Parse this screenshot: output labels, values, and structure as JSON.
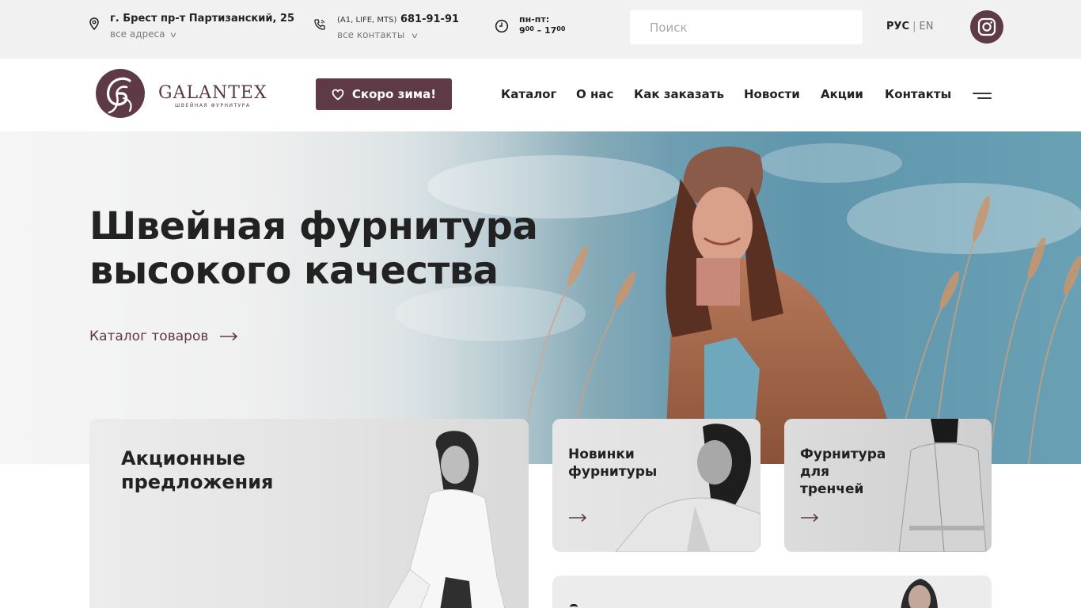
{
  "topbar": {
    "address": "г. Брест пр-т Партизанский, 25",
    "all_addresses": "все адреса",
    "phone_carriers": "(A1, LIFE, MTS)",
    "phone_number": "681-91-91",
    "all_contacts": "все контакты",
    "hours_days": "пн-пт:",
    "hours_from": "9",
    "hours_from_min": "00",
    "hours_dash": " – ",
    "hours_to": "17",
    "hours_to_min": "00",
    "search_placeholder": "Поиск",
    "lang_active": "РУС",
    "lang_separator": "|",
    "lang_other": "EN",
    "icons": [
      "location-pin-icon",
      "phone-icon",
      "clock-icon",
      "instagram-icon"
    ]
  },
  "header": {
    "logo_text": "GALANTEX",
    "logo_subtitle": "ШВЕЙНАЯ ФУРНИТУРА",
    "promo_button": "Скоро зима!",
    "nav": [
      "Каталог",
      "О нас",
      "Как заказать",
      "Новости",
      "Акции",
      "Контакты"
    ]
  },
  "hero": {
    "title_line1": "Швейная фурнитура",
    "title_line2": "высокого качества",
    "catalog_link": "Каталог товаров"
  },
  "cards": {
    "promo_line1": "Акционные",
    "promo_line2": "предложения",
    "new_line1": "Новинки",
    "new_line2": "фурнитуры",
    "trench_line1": "Фурнитура",
    "trench_line2": "для",
    "trench_line3": "тренчей"
  },
  "colors": {
    "brand": "#5d3a45",
    "topbar_bg": "#f1f1f1",
    "text": "#222222"
  }
}
